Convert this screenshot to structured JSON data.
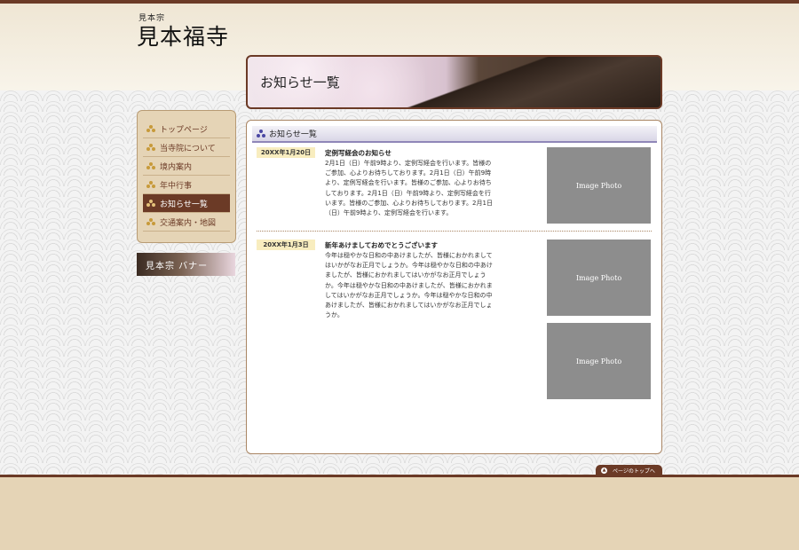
{
  "header": {
    "logo_small": "見本宗",
    "logo_main": "見本福寺"
  },
  "hero": {
    "title": "お知らせ一覧"
  },
  "sidebar": {
    "items": [
      {
        "label": "トップページ"
      },
      {
        "label": "当寺院について"
      },
      {
        "label": "境内案内"
      },
      {
        "label": "年中行事"
      },
      {
        "label": "お知らせ一覧"
      },
      {
        "label": "交通案内・地図"
      }
    ],
    "active_index": 4,
    "banner_label": "見本宗 バナー"
  },
  "content": {
    "heading": "お知らせ一覧",
    "news": [
      {
        "date": "20XX年1月20日",
        "title": "定例写経会のお知らせ",
        "body": "2月1日（日）午前9時より、定例写経会を行います。皆様のご参加、心よりお待ちしております。2月1日（日）午前9時より、定例写経会を行います。皆様のご参加、心よりお待ちしております。2月1日（日）午前9時より、定例写経会を行います。皆様のご参加、心よりお待ちしております。2月1日（日）午前9時より、定例写経会を行います。",
        "photos": [
          "Image Photo"
        ]
      },
      {
        "date": "20XX年1月3日",
        "title": "新年あけましておめでとうございます",
        "body": "今年は穏やかな日和の中あけましたが、皆様におかれましてはいかがなお正月でしょうか。今年は穏やかな日和の中あけましたが、皆様におかれましてはいかがなお正月でしょうか。今年は穏やかな日和の中あけましたが、皆様におかれましてはいかがなお正月でしょうか。今年は穏やかな日和の中あけましたが、皆様におかれましてはいかがなお正月でしょうか。",
        "photos": [
          "Image Photo",
          "Image Photo"
        ]
      }
    ]
  },
  "footer": {
    "pagetop_label": "ページのトップへ"
  },
  "colors": {
    "brand_brown": "#6b3a26",
    "beige": "#e5d4b6",
    "date_badge": "#f8edbf",
    "photo_gray": "#8d8d8d",
    "heading_accent": "#8f86b8"
  }
}
